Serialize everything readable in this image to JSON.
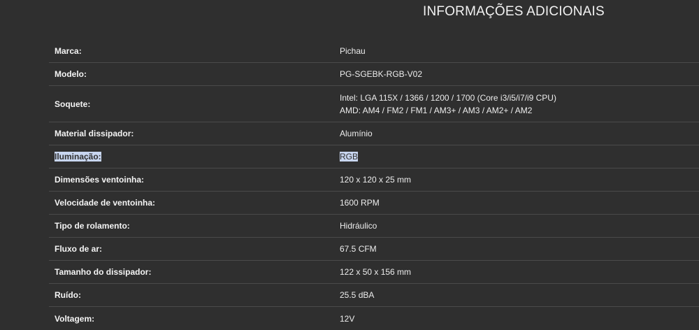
{
  "section": {
    "title": "INFORMAÇÕES ADICIONAIS"
  },
  "specs": [
    {
      "label": "Marca:",
      "value": [
        "Pichau"
      ]
    },
    {
      "label": "Modelo:",
      "value": [
        "PG-SGEBK-RGB-V02"
      ]
    },
    {
      "label": "Soquete:",
      "value": [
        "Intel: LGA 115X / 1366 / 1200 / 1700 (Core i3/i5/i7/i9 CPU)",
        "AMD: AM4 / FM2 / FM1 / AM3+ / AM3 / AM2+ / AM2"
      ]
    },
    {
      "label": "Material dissipador:",
      "value": [
        "Alumínio"
      ]
    },
    {
      "label": "Iluminação:",
      "value": [
        "RGB"
      ],
      "selected": true
    },
    {
      "label": "Dimensões ventoinha:",
      "value": [
        "120 x 120 x 25 mm"
      ]
    },
    {
      "label": "Velocidade de ventoinha:",
      "value": [
        "1600 RPM"
      ]
    },
    {
      "label": "Tipo de rolamento:",
      "value": [
        "Hidráulico"
      ]
    },
    {
      "label": "Fluxo de ar:",
      "value": [
        "67.5 CFM"
      ]
    },
    {
      "label": "Tamanho do dissipador:",
      "value": [
        "122 x 50 x 156 mm"
      ]
    },
    {
      "label": "Ruído:",
      "value": [
        "25.5 dBA"
      ]
    },
    {
      "label": "Voltagem:",
      "value": [
        "12V"
      ]
    }
  ],
  "colors": {
    "background": "#2f2f2f",
    "selection": "#c8d6f0",
    "divider": "#4a4a4a"
  }
}
